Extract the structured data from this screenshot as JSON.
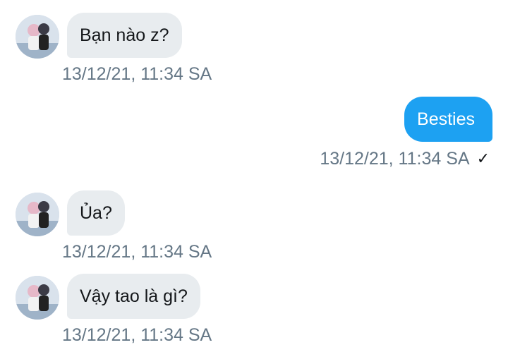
{
  "messages": [
    {
      "direction": "incoming",
      "text": "Bạn nào z?",
      "timestamp": "13/12/21, 11:34 SA"
    },
    {
      "direction": "outgoing",
      "text": "Besties",
      "timestamp": "13/12/21, 11:34 SA",
      "status_icon": "check-icon"
    },
    {
      "direction": "incoming",
      "text": "Ủa?",
      "timestamp": "13/12/21, 11:34 SA"
    },
    {
      "direction": "incoming",
      "text": "Vậy tao là gì?",
      "timestamp": "13/12/21, 11:34 SA"
    }
  ],
  "colors": {
    "outgoing_bubble": "#1da1f2",
    "incoming_bubble": "#e8ecef",
    "timestamp": "#657786"
  },
  "read_mark": "✓"
}
